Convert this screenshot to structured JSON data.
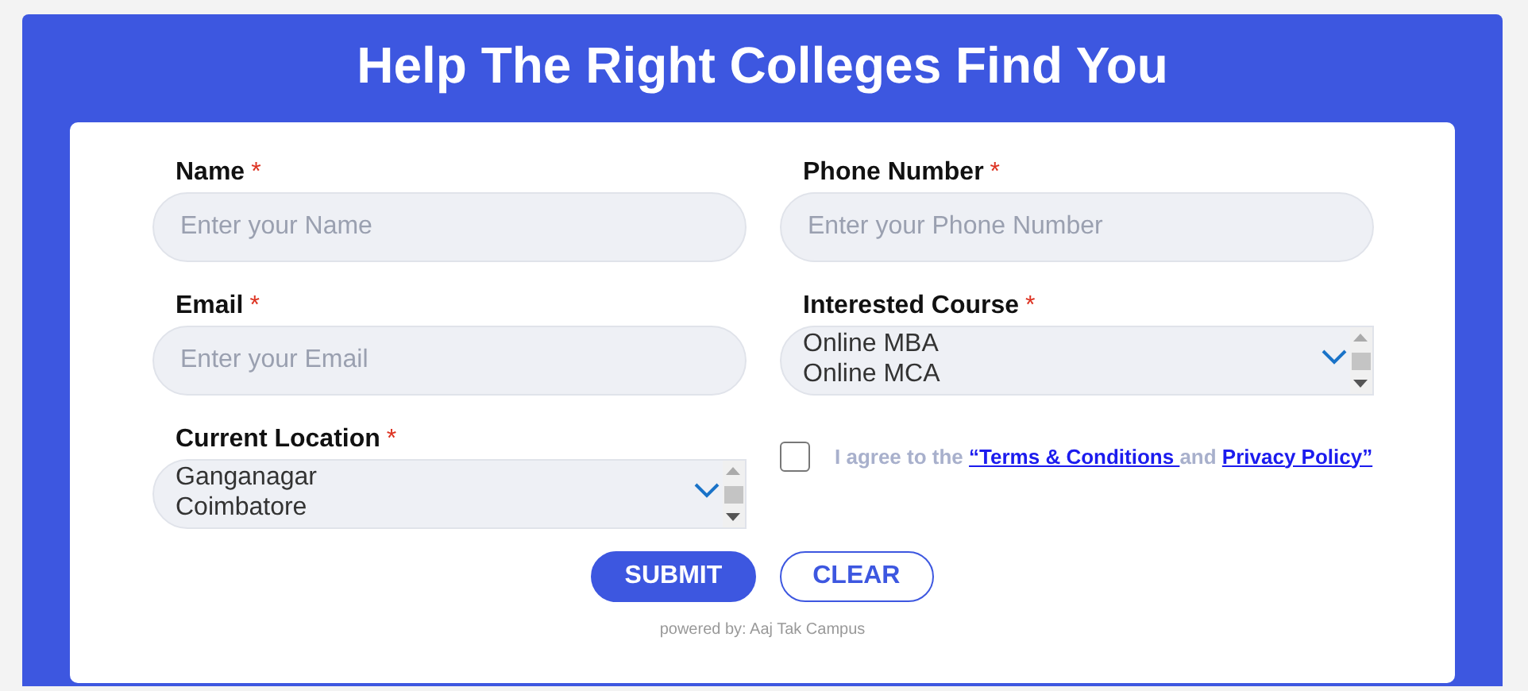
{
  "title": "Help The Right Colleges Find You",
  "fields": [
    {
      "kind": "text",
      "label": "Name",
      "required_mark": "*",
      "placeholder": "Enter your Name"
    },
    {
      "kind": "text",
      "label": "Phone Number",
      "required_mark": "*",
      "placeholder": "Enter your Phone Number"
    },
    {
      "kind": "text",
      "label": "Email",
      "required_mark": "*",
      "placeholder": "Enter your Email"
    },
    {
      "kind": "list",
      "label": "Interested Course",
      "required_mark": "*",
      "options": [
        "Online MBA",
        "Online MCA"
      ]
    },
    {
      "kind": "list",
      "label": "Current Location",
      "required_mark": "*",
      "options": [
        "Ganganagar",
        "Coimbatore"
      ]
    },
    {
      "kind": "agree",
      "checked": false,
      "text_before": "I agree to the",
      "link_1": "“Terms & Conditions ",
      "text_between": "and",
      "link_2": "Privacy Policy”"
    }
  ],
  "buttons": [
    {
      "label": "SUBMIT",
      "kind": "primary"
    },
    {
      "label": "CLEAR",
      "kind": "outline"
    }
  ],
  "footer": "powered by: Aaj Tak Campus"
}
